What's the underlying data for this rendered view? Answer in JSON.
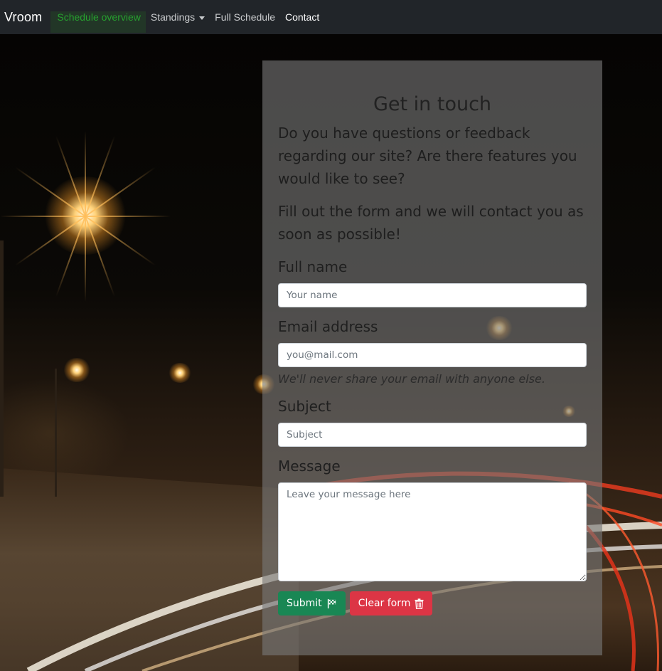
{
  "navbar": {
    "brand": "Vroom",
    "links": {
      "schedule_overview": "Schedule overview",
      "standings": "Standings",
      "full_schedule": "Full Schedule",
      "contact": "Contact"
    }
  },
  "contact_form": {
    "title": "Get in touch",
    "intro_1": "Do you have questions or feedback regarding our site? Are there features you would like to see?",
    "intro_2": "Fill out the form and we will contact you as soon as possible!",
    "full_name": {
      "label": "Full name",
      "placeholder": "Your name",
      "value": ""
    },
    "email": {
      "label": "Email address",
      "placeholder": "you@mail.com",
      "value": "",
      "help": "We'll never share your email with anyone else."
    },
    "subject": {
      "label": "Subject",
      "placeholder": "Subject",
      "value": ""
    },
    "message": {
      "label": "Message",
      "placeholder": "Leave your message here",
      "value": ""
    },
    "submit_label": "Submit",
    "clear_label": "Clear form",
    "submit_icon": "flag-icon",
    "clear_icon": "trash-icon"
  },
  "colors": {
    "navbar_bg": "#212529",
    "active_link": "#27a02f",
    "submit": "#198754",
    "clear": "#dc3545"
  }
}
